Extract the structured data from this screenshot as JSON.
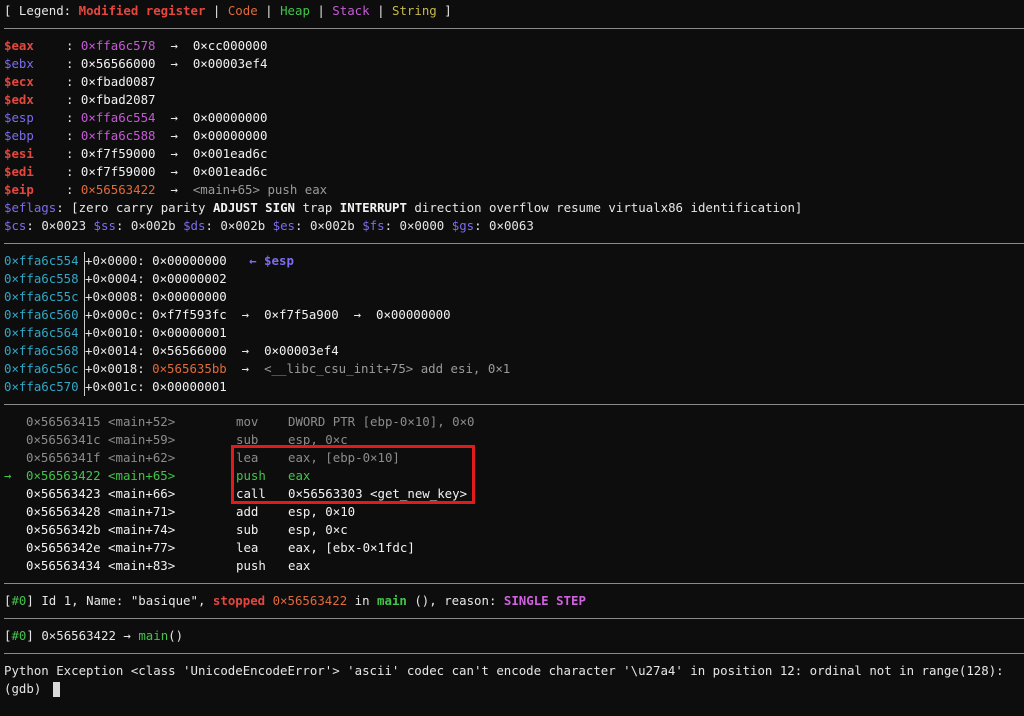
{
  "legend": {
    "prefix": "[ Legend: ",
    "modified": "Modified register",
    "code": "Code",
    "heap": "Heap",
    "stack": "Stack",
    "string": "String",
    "suffix": " ]",
    "bar": " | "
  },
  "registers": [
    {
      "name": "$eax",
      "value": "0×ffa6c578",
      "chain": [
        "0×cc000000"
      ],
      "modified": true,
      "value_color": "mag"
    },
    {
      "name": "$ebx",
      "value": "0×56566000",
      "chain": [
        "0×00003ef4"
      ],
      "modified": false,
      "value_color": "white"
    },
    {
      "name": "$ecx",
      "value": "0×fbad0087",
      "chain": [],
      "modified": true,
      "value_color": "white"
    },
    {
      "name": "$edx",
      "value": "0×fbad2087",
      "chain": [],
      "modified": true,
      "value_color": "white"
    },
    {
      "name": "$esp",
      "value": "0×ffa6c554",
      "chain": [
        "0×00000000"
      ],
      "modified": false,
      "value_color": "mag"
    },
    {
      "name": "$ebp",
      "value": "0×ffa6c588",
      "chain": [
        "0×00000000"
      ],
      "modified": false,
      "value_color": "mag"
    },
    {
      "name": "$esi",
      "value": "0×f7f59000",
      "chain": [
        "0×001ead6c"
      ],
      "modified": true,
      "value_color": "white"
    },
    {
      "name": "$edi",
      "value": "0×f7f59000",
      "chain": [
        "0×001ead6c"
      ],
      "modified": true,
      "value_color": "white"
    },
    {
      "name": "$eip",
      "value": "0×56563422",
      "chain": [
        "<main+65> push eax"
      ],
      "modified": true,
      "value_color": "orange"
    }
  ],
  "eflags": {
    "name": "$eflags",
    "open": ": [",
    "flags": [
      {
        "t": "zero",
        "b": false
      },
      {
        "t": "carry",
        "b": false
      },
      {
        "t": "parity",
        "b": false
      },
      {
        "t": "ADJUST",
        "b": true
      },
      {
        "t": "SIGN",
        "b": true
      },
      {
        "t": "trap",
        "b": false
      },
      {
        "t": "INTERRUPT",
        "b": true
      },
      {
        "t": "direction",
        "b": false
      },
      {
        "t": "overflow",
        "b": false
      },
      {
        "t": "resume",
        "b": false
      },
      {
        "t": "virtualx86",
        "b": false
      },
      {
        "t": "identification",
        "b": false
      }
    ],
    "close": "]"
  },
  "segments": [
    {
      "name": "$cs",
      "value": "0×0023"
    },
    {
      "name": "$ss",
      "value": "0×002b"
    },
    {
      "name": "$ds",
      "value": "0×002b"
    },
    {
      "name": "$es",
      "value": "0×002b"
    },
    {
      "name": "$fs",
      "value": "0×0000"
    },
    {
      "name": "$gs",
      "value": "0×0063"
    }
  ],
  "stack": [
    {
      "addr": "0×ffa6c554",
      "off": "+0×0000:",
      "val": "0×00000000",
      "val_color": "white",
      "chain": [],
      "note": "← $esp"
    },
    {
      "addr": "0×ffa6c558",
      "off": "+0×0004:",
      "val": "0×00000002",
      "val_color": "white",
      "chain": [],
      "note": ""
    },
    {
      "addr": "0×ffa6c55c",
      "off": "+0×0008:",
      "val": "0×00000000",
      "val_color": "white",
      "chain": [],
      "note": ""
    },
    {
      "addr": "0×ffa6c560",
      "off": "+0×000c:",
      "val": "0×f7f593fc",
      "val_color": "white",
      "chain": [
        "0×f7f5a900",
        "0×00000000"
      ],
      "note": ""
    },
    {
      "addr": "0×ffa6c564",
      "off": "+0×0010:",
      "val": "0×00000001",
      "val_color": "white",
      "chain": [],
      "note": ""
    },
    {
      "addr": "0×ffa6c568",
      "off": "+0×0014:",
      "val": "0×56566000",
      "val_color": "white",
      "chain": [
        "0×00003ef4"
      ],
      "note": ""
    },
    {
      "addr": "0×ffa6c56c",
      "off": "+0×0018:",
      "val": "0×565635bb",
      "val_color": "orange",
      "chain": [
        "<__libc_csu_init+75> add esi, 0×1"
      ],
      "note": ""
    },
    {
      "addr": "0×ffa6c570",
      "off": "+0×001c:",
      "val": "0×00000001",
      "val_color": "white",
      "chain": [],
      "note": ""
    }
  ],
  "code": [
    {
      "marker": "",
      "addr": "0×56563415 <main+52>",
      "mnem": "mov",
      "ops": "DWORD PTR [ebp-0×10], 0×0",
      "state": "past"
    },
    {
      "marker": "",
      "addr": "0×5656341c <main+59>",
      "mnem": "sub",
      "ops": "esp, 0×c",
      "state": "past"
    },
    {
      "marker": "",
      "addr": "0×5656341f <main+62>",
      "mnem": "lea",
      "ops": "eax, [ebp-0×10]",
      "state": "past"
    },
    {
      "marker": "→",
      "addr": "0×56563422 <main+65>",
      "mnem": "push",
      "ops": "eax",
      "state": "current"
    },
    {
      "marker": "",
      "addr": "0×56563423 <main+66>",
      "mnem": "call",
      "ops": "0×56563303 <get_new_key>",
      "state": "future"
    },
    {
      "marker": "",
      "addr": "0×56563428 <main+71>",
      "mnem": "add",
      "ops": "esp, 0×10",
      "state": "future"
    },
    {
      "marker": "",
      "addr": "0×5656342b <main+74>",
      "mnem": "sub",
      "ops": "esp, 0×c",
      "state": "future"
    },
    {
      "marker": "",
      "addr": "0×5656342e <main+77>",
      "mnem": "lea",
      "ops": "eax, [ebx-0×1fdc]",
      "state": "future"
    },
    {
      "marker": "",
      "addr": "0×56563434 <main+83>",
      "mnem": "push",
      "ops": "eax",
      "state": "future"
    }
  ],
  "threads": {
    "idx": "#0",
    "text1": " Id 1, Name: \"basique\", ",
    "stopped": "stopped",
    "addr": "0×56563422",
    "in": " in ",
    "func": "main",
    "text2": " (), reason: ",
    "reason": "SINGLE STEP"
  },
  "trace": {
    "idx": "#0",
    "addr": "0×56563422",
    "arrow": " → ",
    "func": "main",
    "tail": "()"
  },
  "exception": "Python Exception <class 'UnicodeEncodeError'> 'ascii' codec can't encode character '\\u27a4' in position 12: ordinal not in range(128):",
  "prompt": "(gdb) ",
  "colors": {
    "modified": "#e5473f",
    "code": "#e06a3a",
    "heap": "#43c34a",
    "stack": "#c55ad6",
    "string": "#c7b94a",
    "unmodified_reg": "#7c6cf2",
    "stack_addr": "#32a6c4",
    "highlight_box": "#e01b1b"
  }
}
